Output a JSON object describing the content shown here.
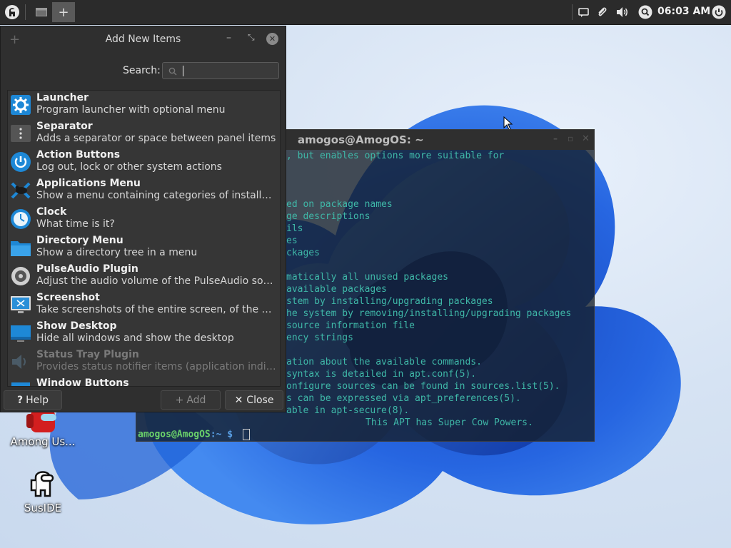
{
  "panel": {
    "clock": "06:03 AM"
  },
  "desktop_icons": [
    {
      "label": "Among Us..."
    },
    {
      "label": "SusIDE"
    }
  ],
  "terminal": {
    "title": "amogos@AmogOS: ~",
    "lines": [
      ", but enables options more suitable for",
      "ed on package names",
      "ge descriptions",
      "ils",
      "es",
      "ckages",
      "matically all unused packages",
      "available packages",
      "stem by installing/upgrading packages",
      "he system by removing/installing/upgrading packages",
      "source information file",
      "ency strings",
      "ation about the available commands.",
      "syntax is detailed in apt.conf(5).",
      "onfigure sources can be found in sources.list(5).",
      "s can be expressed via apt_preferences(5).",
      "able in apt-secure(8).",
      "This APT has Super Cow Powers."
    ],
    "prompt_user": "amogos@AmogOS",
    "prompt_path": ":~ $"
  },
  "dialog": {
    "title": "Add New Items",
    "search_label": "Search:",
    "search_value": "",
    "items": [
      {
        "name": "Launcher",
        "desc": "Program launcher with optional menu",
        "icon": "gear-icon"
      },
      {
        "name": "Separator",
        "desc": "Adds a separator or space between panel items",
        "icon": "separator-icon"
      },
      {
        "name": "Action Buttons",
        "desc": "Log out, lock or other system actions",
        "icon": "power-icon"
      },
      {
        "name": "Applications Menu",
        "desc": "Show a menu containing categories of installed applications",
        "icon": "xfce-mouse-icon"
      },
      {
        "name": "Clock",
        "desc": "What time is it?",
        "icon": "clock-icon"
      },
      {
        "name": "Directory Menu",
        "desc": "Show a directory tree in a menu",
        "icon": "folder-icon"
      },
      {
        "name": "PulseAudio Plugin",
        "desc": "Adjust the audio volume of the PulseAudio sound system",
        "icon": "speaker-icon"
      },
      {
        "name": "Screenshot",
        "desc": "Take screenshots of the entire screen, of the active window or of a region",
        "icon": "screenshot-icon"
      },
      {
        "name": "Show Desktop",
        "desc": "Hide all windows and show the desktop",
        "icon": "desktop-icon"
      },
      {
        "name": "Status Tray Plugin",
        "desc": "Provides status notifier items (application indicators)",
        "icon": "tray-icon"
      },
      {
        "name": "Window Buttons",
        "desc": "",
        "icon": "window-icon"
      }
    ],
    "help_label": "Help",
    "add_label": "Add",
    "close_label": "Close"
  },
  "colors": {
    "accent_blue": "#1e88d6",
    "terminal_text": "#3fb8a8",
    "prompt_green": "#6ad16a"
  }
}
